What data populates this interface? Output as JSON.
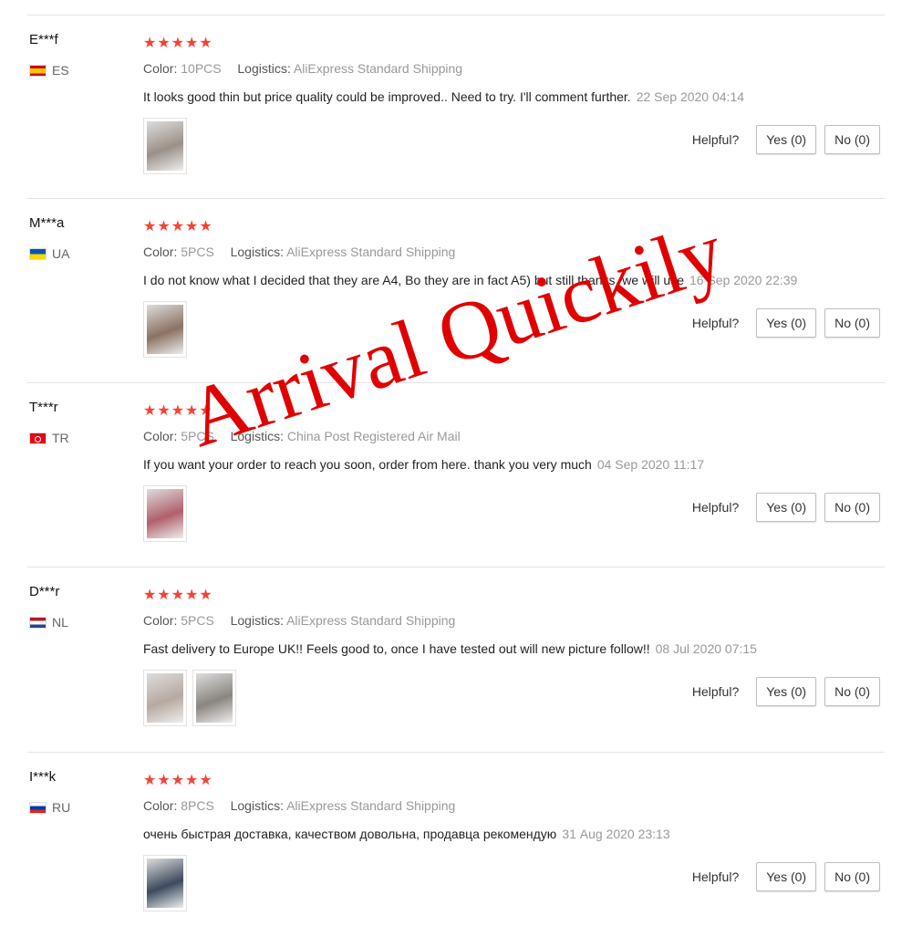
{
  "labels": {
    "color": "Color:",
    "logistics": "Logistics:",
    "helpful": "Helpful?"
  },
  "stars_glyph": "★★★★★",
  "watermark_text": "Arrival Quickily",
  "reviews": [
    {
      "user": "E***f",
      "country": "ES",
      "flag": "es",
      "rating": 5,
      "color": "10PCS",
      "logistics": "AliExpress Standard Shipping",
      "text": "It looks good thin but price quality could be improved.. Need to try. I'll comment further.",
      "date": "22 Sep 2020 04:14",
      "yes": "Yes (0)",
      "no": "No (0)",
      "photos": [
        "#9b9088"
      ]
    },
    {
      "user": "M***a",
      "country": "UA",
      "flag": "ua",
      "rating": 5,
      "color": "5PCS",
      "logistics": "AliExpress Standard Shipping",
      "text": "I do not know what I decided that they are A4, Bo they are in fact A5) but still thanks, we will use",
      "date": "16 Sep 2020 22:39",
      "yes": "Yes (0)",
      "no": "No (0)",
      "photos": [
        "#8b7262"
      ]
    },
    {
      "user": "T***r",
      "country": "TR",
      "flag": "tr",
      "rating": 5,
      "color": "5PCS",
      "logistics": "China Post Registered Air Mail",
      "text": "If you want your order to reach you soon, order from here. thank you very much",
      "date": "04 Sep 2020 11:17",
      "yes": "Yes (0)",
      "no": "No (0)",
      "photos": [
        "#b0606b"
      ]
    },
    {
      "user": "D***r",
      "country": "NL",
      "flag": "nl",
      "rating": 5,
      "color": "5PCS",
      "logistics": "AliExpress Standard Shipping",
      "text": "Fast delivery to Europe UK!! Feels good to, once I have tested out will new picture follow!!",
      "date": "08 Jul 2020 07:15",
      "yes": "Yes (0)",
      "no": "No (0)",
      "photos": [
        "#b7a9a0",
        "#8a8580"
      ]
    },
    {
      "user": "I***k",
      "country": "RU",
      "flag": "ru",
      "rating": 5,
      "color": "8PCS",
      "logistics": "AliExpress Standard Shipping",
      "text": "очень быстрая доставка, качеством довольна, продавца рекомендую",
      "date": "31 Aug 2020 23:13",
      "yes": "Yes (0)",
      "no": "No (0)",
      "photos": [
        "#3c4a5e"
      ]
    }
  ]
}
